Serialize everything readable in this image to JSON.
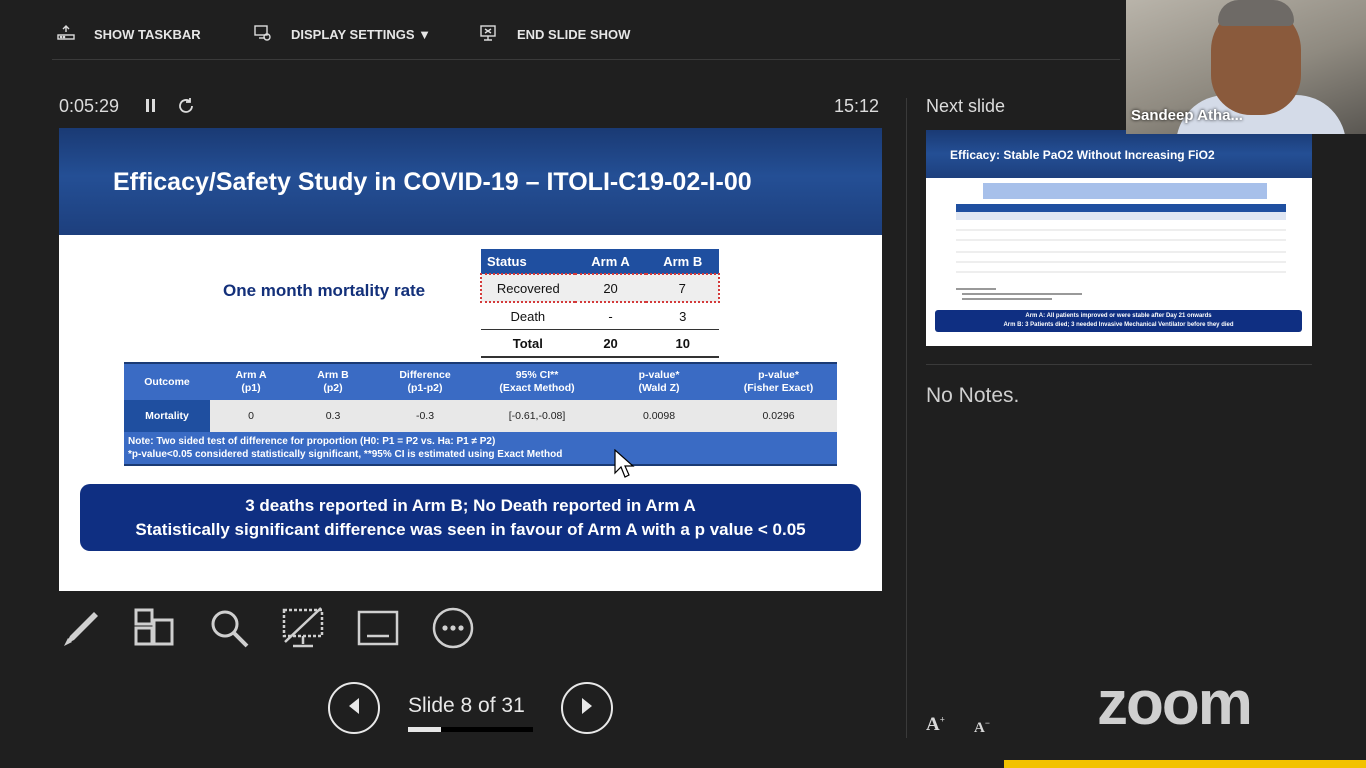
{
  "toolbar": {
    "show_taskbar": "SHOW TASKBAR",
    "display_settings": "DISPLAY SETTINGS ▼",
    "end_slide_show": "END SLIDE SHOW"
  },
  "presenter": {
    "elapsed": "0:05:29",
    "clock": "15:12",
    "slide_counter": "Slide 8 of 31",
    "progress": 0.26
  },
  "slide": {
    "title": "Efficacy/Safety Study in COVID-19 – ITOLI-C19-02-I-00",
    "mortality_label": "One month mortality rate",
    "status_table": {
      "headers": [
        "Status",
        "Arm A",
        "Arm B"
      ],
      "rows": [
        [
          "Recovered",
          "20",
          "7"
        ],
        [
          "Death",
          "-",
          "3"
        ],
        [
          "Total",
          "20",
          "10"
        ]
      ]
    },
    "outcome_table": {
      "headers": [
        [
          "Outcome",
          ""
        ],
        [
          "Arm A",
          "(p1)"
        ],
        [
          "Arm B",
          "(p2)"
        ],
        [
          "Difference",
          "(p1-p2)"
        ],
        [
          "95% CI**",
          "(Exact Method)"
        ],
        [
          "p-value*",
          "(Wald Z)"
        ],
        [
          "p-value*",
          "(Fisher Exact)"
        ]
      ],
      "row": [
        "Mortality",
        "0",
        "0.3",
        "-0.3",
        "[-0.61,-0.08]",
        "0.0098",
        "0.0296"
      ],
      "note1": "Note: Two sided test of difference for proportion (H0: P1 = P2 vs. Ha: P1 ≠ P2)",
      "note2": "*p-value<0.05 considered statistically significant, **95% CI is estimated using Exact Method"
    },
    "summary_line1": "3 deaths reported in Arm B; No Death reported in Arm A",
    "summary_line2": "Statistically significant difference was seen in favour of Arm A with a p value < 0.05"
  },
  "right_panel": {
    "next_label": "Next slide",
    "next_title": "Efficacy: Stable PaO2 Without Increasing FiO2",
    "next_footer1": "Arm A: All patients improved or were stable after Day 21 onwards",
    "next_footer2": "Arm B: 3 Patients died; 3 needed Invasive Mechanical Ventilator before they died",
    "notes": "No Notes."
  },
  "video": {
    "participant_name": "Sandeep Atha..."
  },
  "branding": {
    "logo": "zoom"
  },
  "colors": {
    "background": "#1f1f1f",
    "slide_blue": "#1f4fa0",
    "summary_navy": "#0f2f82",
    "highlight_red": "#d43a3a",
    "zoom_yellow": "#f2c200"
  }
}
